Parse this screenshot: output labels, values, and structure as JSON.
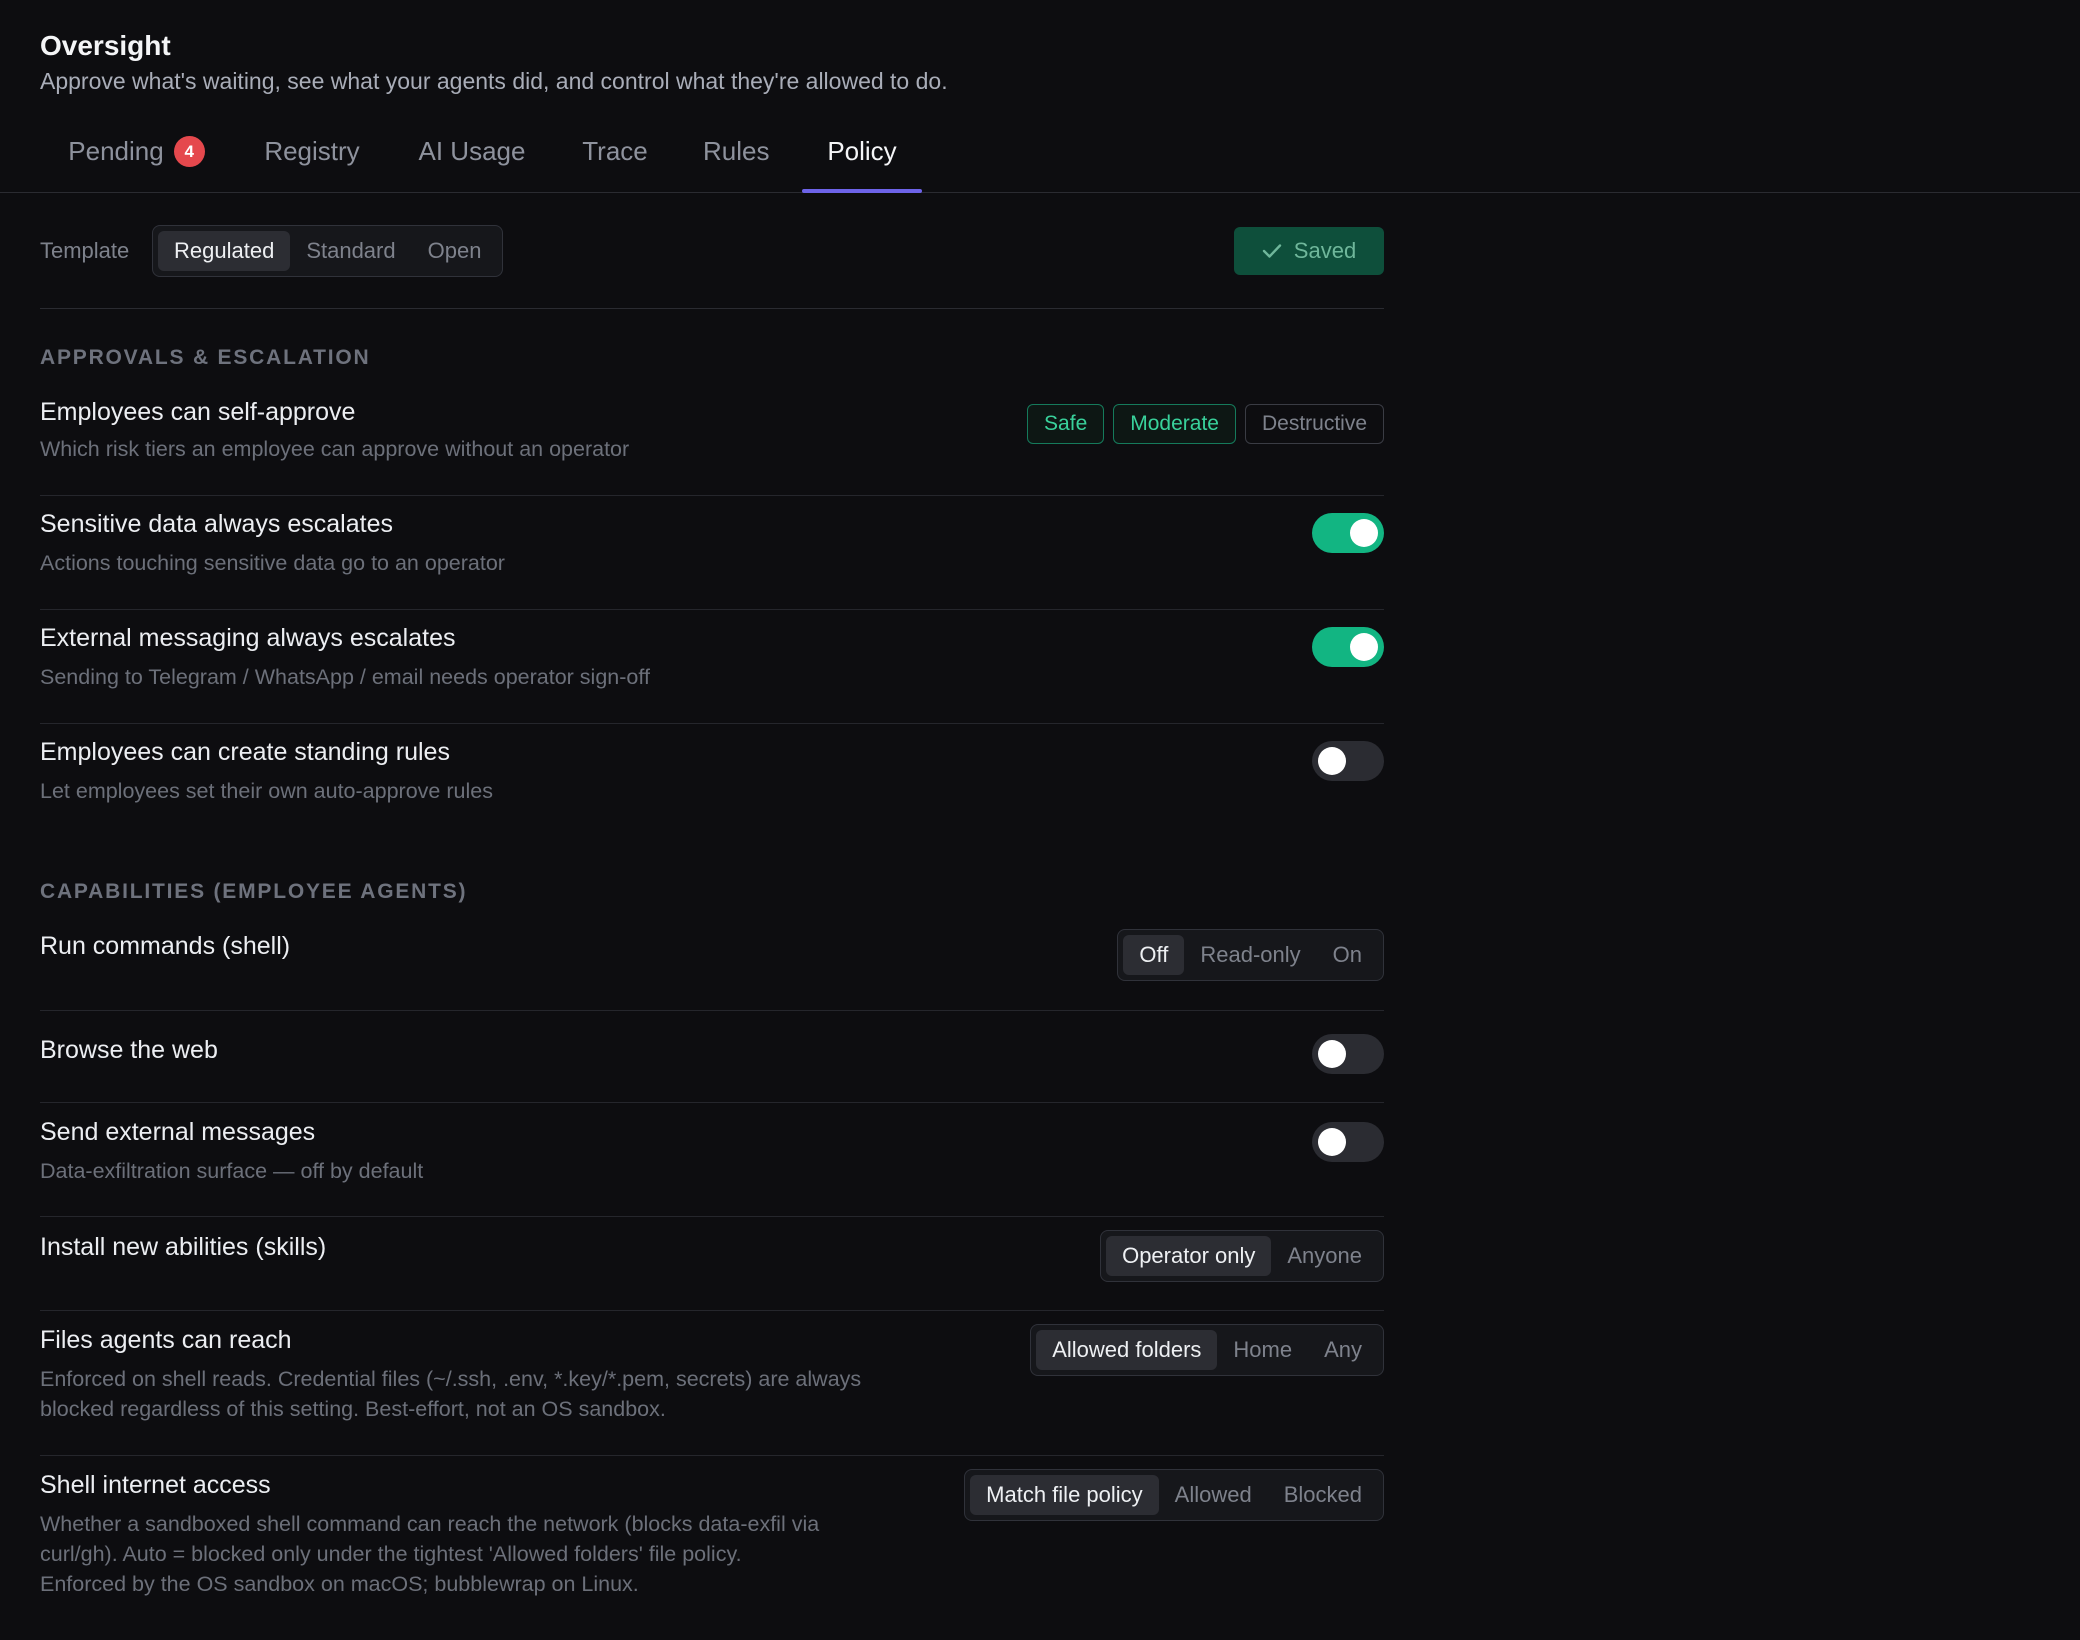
{
  "header": {
    "title": "Oversight",
    "subtitle": "Approve what's waiting, see what your agents did, and control what they're allowed to do."
  },
  "tabs": [
    {
      "label": "Pending",
      "badge": "4"
    },
    {
      "label": "Registry"
    },
    {
      "label": "AI Usage"
    },
    {
      "label": "Trace"
    },
    {
      "label": "Rules"
    },
    {
      "label": "Policy",
      "active": true
    }
  ],
  "template": {
    "label": "Template",
    "options": [
      "Regulated",
      "Standard",
      "Open"
    ],
    "selected": "Regulated",
    "saved_label": "Saved"
  },
  "approvals": {
    "section_title": "APPROVALS & ESCALATION",
    "self_approve": {
      "title": "Employees can self-approve",
      "desc": "Which risk tiers an employee can approve without an operator",
      "tiers": [
        "Safe",
        "Moderate",
        "Destructive"
      ],
      "enabled_tiers": [
        "Safe",
        "Moderate"
      ]
    },
    "sensitive": {
      "title": "Sensitive data always escalates",
      "desc": "Actions touching sensitive data go to an operator",
      "on": true
    },
    "external_messaging": {
      "title": "External messaging always escalates",
      "desc": "Sending to Telegram / WhatsApp / email needs operator sign-off",
      "on": true
    },
    "standing_rules": {
      "title": "Employees can create standing rules",
      "desc": "Let employees set their own auto-approve rules",
      "on": false
    }
  },
  "capabilities": {
    "section_title": "CAPABILITIES (EMPLOYEE AGENTS)",
    "shell": {
      "title": "Run commands (shell)",
      "options": [
        "Off",
        "Read-only",
        "On"
      ],
      "selected": "Off"
    },
    "browse": {
      "title": "Browse the web",
      "on": false
    },
    "send_external": {
      "title": "Send external messages",
      "desc": "Data-exfiltration surface — off by default",
      "on": false
    },
    "skills": {
      "title": "Install new abilities (skills)",
      "options": [
        "Operator only",
        "Anyone"
      ],
      "selected": "Operator only"
    },
    "files": {
      "title": "Files agents can reach",
      "desc_line1": "Enforced on shell reads. Credential files (~/.ssh, .env, *.key/*.pem, secrets) are always",
      "desc_line2": "blocked regardless of this setting. Best-effort, not an OS sandbox.",
      "options": [
        "Allowed folders",
        "Home",
        "Any"
      ],
      "selected": "Allowed folders"
    },
    "internet": {
      "title": "Shell internet access",
      "desc_line1": "Whether a sandboxed shell command can reach the network (blocks data-exfil via",
      "desc_line2": "curl/gh). Auto = blocked only under the tightest 'Allowed folders' file policy.",
      "desc_line3": "Enforced by the OS sandbox on macOS; bubblewrap on Linux.",
      "options": [
        "Match file policy",
        "Allowed",
        "Blocked"
      ],
      "selected": "Match file policy"
    }
  },
  "colors": {
    "accent": "#6d63e8",
    "toggle_on": "#12b582",
    "badge": "#e5484d"
  }
}
